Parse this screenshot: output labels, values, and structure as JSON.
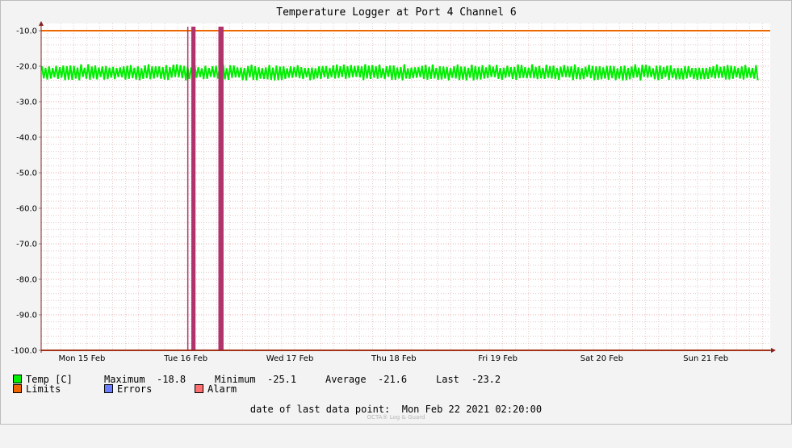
{
  "chart_data": {
    "type": "line",
    "title": "Temperature Logger at Port 4 Channel 6",
    "ylabel": "",
    "xlabel": "",
    "ylim": [
      -100,
      -10
    ],
    "y_ticks": [
      "-10.0",
      "-20.0",
      "-30.0",
      "-40.0",
      "-50.0",
      "-60.0",
      "-70.0",
      "-80.0",
      "-90.0",
      "-100.0"
    ],
    "x_tick_labels": [
      "Mon 15 Feb",
      "Tue 16 Feb",
      "Wed 17 Feb",
      "Thu 18 Feb",
      "Fri 19 Feb",
      "Sat 20 Feb",
      "Sun 21 Feb"
    ],
    "grid": true,
    "series": [
      {
        "name": "Temp [C]",
        "color": "#00ee00",
        "kind": "line",
        "x_days": [
          0.0,
          0.25,
          0.5,
          0.75,
          1.0,
          1.25,
          1.5,
          1.75,
          2.0,
          2.25,
          2.5,
          2.75,
          3.0,
          3.25,
          3.5,
          3.75,
          4.0,
          4.25,
          4.5,
          4.75,
          5.0,
          5.25,
          5.5,
          5.75,
          6.0,
          6.25,
          6.5,
          6.75,
          7.0
        ],
        "values": [
          -21.5,
          -21.8,
          -21.4,
          -21.9,
          -21.6,
          -21.3,
          -21.7,
          -21.5,
          -21.9,
          -21.4,
          -21.6,
          -21.8,
          -21.5,
          -21.7,
          -21.4,
          -21.6,
          -21.8,
          -21.5,
          -21.7,
          -21.4,
          -21.6,
          -21.9,
          -21.5,
          -21.7,
          -21.6,
          -21.4,
          -21.8,
          -21.6,
          -21.7
        ],
        "band_low": -23.5,
        "band_high": -20.0
      },
      {
        "name": "Limits",
        "color": "#ee6600",
        "kind": "hline",
        "values": [
          -10,
          -100
        ]
      },
      {
        "name": "Errors",
        "color": "#6c7dff",
        "kind": "event",
        "values": []
      },
      {
        "name": "Alarm",
        "color": "#ff6f6f",
        "kind": "event",
        "values": []
      }
    ],
    "alarm_events": [
      {
        "start_day": 1.28,
        "end_day": 1.29,
        "color": "#b0336b"
      },
      {
        "start_day": 1.32,
        "end_day": 1.36,
        "color": "#b0336b"
      },
      {
        "start_day": 1.58,
        "end_day": 1.63,
        "color": "#b0336b"
      }
    ]
  },
  "legend": {
    "temp_label": "Temp [C]",
    "maximum_label": "Maximum",
    "maximum_value": "-18.8",
    "minimum_label": "Minimum",
    "minimum_value": "-25.1",
    "average_label": "Average",
    "average_value": "-21.6",
    "last_label": "Last",
    "last_value": "-23.2",
    "limits_label": "Limits",
    "errors_label": "Errors",
    "alarm_label": "Alarm",
    "colors": {
      "temp": "#00ee00",
      "limits": "#ee6600",
      "errors": "#6c7dff",
      "alarm": "#ff6f6f"
    }
  },
  "footer": {
    "last_point_label": "date of last data point:",
    "last_point_value": "Mon Feb 22 2021 02:20:00",
    "watermark": "OCTA® Log & Guard"
  }
}
